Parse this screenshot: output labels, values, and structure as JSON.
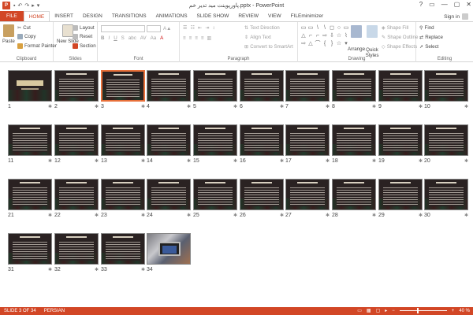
{
  "window": {
    "title": "پاورپوینت مید تدیر خم.pptx - PowerPoint",
    "controls": [
      "?",
      "▭",
      "—",
      "▢",
      "✕"
    ]
  },
  "tabs": [
    "FILE",
    "HOME",
    "INSERT",
    "DESIGN",
    "TRANSITIONS",
    "ANIMATIONS",
    "SLIDE SHOW",
    "REVIEW",
    "VIEW",
    "FILEminimizer"
  ],
  "signin": "Sign in",
  "ribbon": {
    "clipboard": {
      "label": "Clipboard",
      "paste": "Paste",
      "cut": "Cut",
      "copy": "Copy",
      "format_painter": "Format Painter"
    },
    "slides": {
      "label": "Slides",
      "new_slide": "New Slide",
      "layout": "Layout",
      "reset": "Reset",
      "section": "Section"
    },
    "font": {
      "label": "Font",
      "bold": "B",
      "italic": "I",
      "underline": "U",
      "strike": "S",
      "abc": "abc",
      "av": "AV",
      "aa": "Aa",
      "font_color": "A"
    },
    "paragraph": {
      "label": "Paragraph",
      "text_direction": "Text Direction",
      "align_text": "Align Text",
      "convert_smartart": "Convert to SmartArt"
    },
    "drawing": {
      "label": "Drawing",
      "arrange": "Arrange",
      "quick_styles": "Quick Styles",
      "shape_fill": "Shape Fill",
      "shape_outline": "Shape Outline",
      "shape_effects": "Shape Effects"
    },
    "editing": {
      "label": "Editing",
      "find": "Find",
      "replace": "Replace",
      "select": "Select"
    }
  },
  "shapes": [
    "▭",
    "▭",
    "\\",
    "\\",
    "◻",
    "○",
    "▭",
    "△",
    "⌐",
    "⌐",
    "⇨",
    "⇩",
    "☆",
    "⌇",
    "⇨",
    "△",
    "⌒",
    "{",
    "}",
    "☆",
    "▾"
  ],
  "slides": [
    {
      "n": "1",
      "kind": "title"
    },
    {
      "n": "2",
      "kind": "text"
    },
    {
      "n": "3",
      "kind": "text",
      "selected": true
    },
    {
      "n": "4",
      "kind": "text"
    },
    {
      "n": "5",
      "kind": "text"
    },
    {
      "n": "6",
      "kind": "text"
    },
    {
      "n": "7",
      "kind": "text"
    },
    {
      "n": "8",
      "kind": "text"
    },
    {
      "n": "9",
      "kind": "text"
    },
    {
      "n": "10",
      "kind": "text"
    },
    {
      "n": "11",
      "kind": "text"
    },
    {
      "n": "12",
      "kind": "text"
    },
    {
      "n": "13",
      "kind": "text"
    },
    {
      "n": "14",
      "kind": "text"
    },
    {
      "n": "15",
      "kind": "text"
    },
    {
      "n": "16",
      "kind": "text"
    },
    {
      "n": "17",
      "kind": "text"
    },
    {
      "n": "18",
      "kind": "text"
    },
    {
      "n": "19",
      "kind": "text"
    },
    {
      "n": "20",
      "kind": "text"
    },
    {
      "n": "21",
      "kind": "text"
    },
    {
      "n": "22",
      "kind": "text"
    },
    {
      "n": "23",
      "kind": "text"
    },
    {
      "n": "24",
      "kind": "text"
    },
    {
      "n": "25",
      "kind": "text"
    },
    {
      "n": "26",
      "kind": "text"
    },
    {
      "n": "27",
      "kind": "text"
    },
    {
      "n": "28",
      "kind": "text"
    },
    {
      "n": "29",
      "kind": "text"
    },
    {
      "n": "30",
      "kind": "text"
    },
    {
      "n": "31",
      "kind": "text"
    },
    {
      "n": "32",
      "kind": "text"
    },
    {
      "n": "33",
      "kind": "text"
    },
    {
      "n": "34",
      "kind": "photo"
    }
  ],
  "status": {
    "slide_info": "SLIDE 3 OF 34",
    "language": "PERSIAN",
    "zoom": "40 %"
  },
  "colors": {
    "accent": "#d24726",
    "selection": "#e8703a"
  }
}
